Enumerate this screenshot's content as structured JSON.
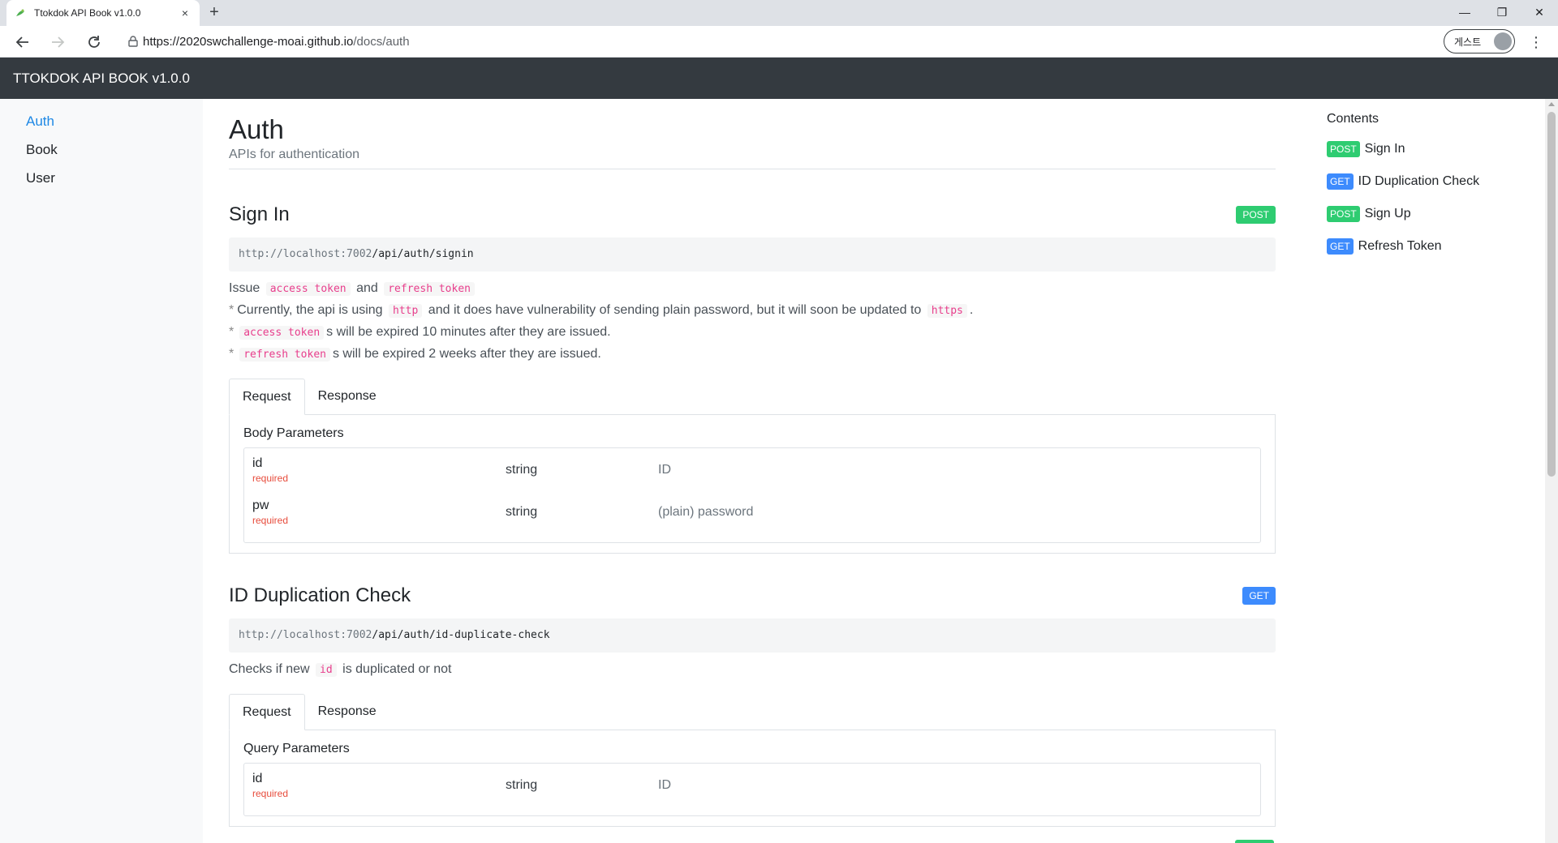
{
  "browser": {
    "tab_title": "Ttokdok API Book v1.0.0",
    "close_glyph": "×",
    "new_tab_glyph": "+",
    "url_host": "https://2020swchallenge-moai.github.io",
    "url_path": "/docs/auth",
    "profile_label": "게스트",
    "menu_glyph": "⋮",
    "minimize_glyph": "—",
    "restore_glyph": "❐",
    "close_window_glyph": "✕"
  },
  "navbar": {
    "brand": "TTOKDOK API BOOK v1.0.0"
  },
  "sidebar": {
    "items": [
      {
        "label": "Auth",
        "active": true
      },
      {
        "label": "Book",
        "active": false
      },
      {
        "label": "User",
        "active": false
      }
    ]
  },
  "page": {
    "title": "Auth",
    "subtitle": "APIs for authentication"
  },
  "apis": [
    {
      "title": "Sign In",
      "method": "POST",
      "url_base": "http://localhost:7002",
      "url_route": "/api/auth/signin",
      "desc": {
        "l1_a": "Issue",
        "l1_code1": "access token",
        "l1_b": "and",
        "l1_code2": "refresh token",
        "bullet": "*",
        "l2_a": "Currently, the api is using",
        "l2_code1": "http",
        "l2_b": "and it does have vulnerability of sending plain password, but it will soon be updated to",
        "l2_code2": "https",
        "l2_c": ".",
        "l3_code": "access token",
        "l3_b": "s will be expired 10 minutes after they are issued.",
        "l4_code": "refresh token",
        "l4_b": "s will be expired 2 weeks after they are issued."
      },
      "tabs": [
        "Request",
        "Response"
      ],
      "panel_title": "Body Parameters",
      "params": [
        {
          "name": "id",
          "required": "required",
          "type": "string",
          "desc": "ID"
        },
        {
          "name": "pw",
          "required": "required",
          "type": "string",
          "desc": "(plain) password"
        }
      ]
    },
    {
      "title": "ID Duplication Check",
      "method": "GET",
      "url_base": "http://localhost:7002",
      "url_route": "/api/auth/id-duplicate-check",
      "desc": {
        "l1_a": "Checks if new",
        "l1_code": "id",
        "l1_b": "is duplicated or not"
      },
      "tabs": [
        "Request",
        "Response"
      ],
      "panel_title": "Query Parameters",
      "params": [
        {
          "name": "id",
          "required": "required",
          "type": "string",
          "desc": "ID"
        }
      ]
    }
  ],
  "toc": {
    "title": "Contents",
    "items": [
      {
        "method": "POST",
        "label": "Sign In"
      },
      {
        "method": "GET",
        "label": "ID Duplication Check"
      },
      {
        "method": "POST",
        "label": "Sign Up"
      },
      {
        "method": "GET",
        "label": "Refresh Token"
      }
    ]
  },
  "colors": {
    "navbar": "#343a40",
    "active_link": "#1e88e5",
    "post_badge": "#2ecc71",
    "get_badge": "#3d8bfd",
    "code_text": "#e83e8c",
    "required_text": "#e74c3c"
  },
  "icons": [
    "favicon-icon",
    "back-arrow-icon",
    "forward-arrow-icon",
    "reload-icon",
    "lock-icon",
    "avatar-icon",
    "kebab-menu-icon"
  ]
}
